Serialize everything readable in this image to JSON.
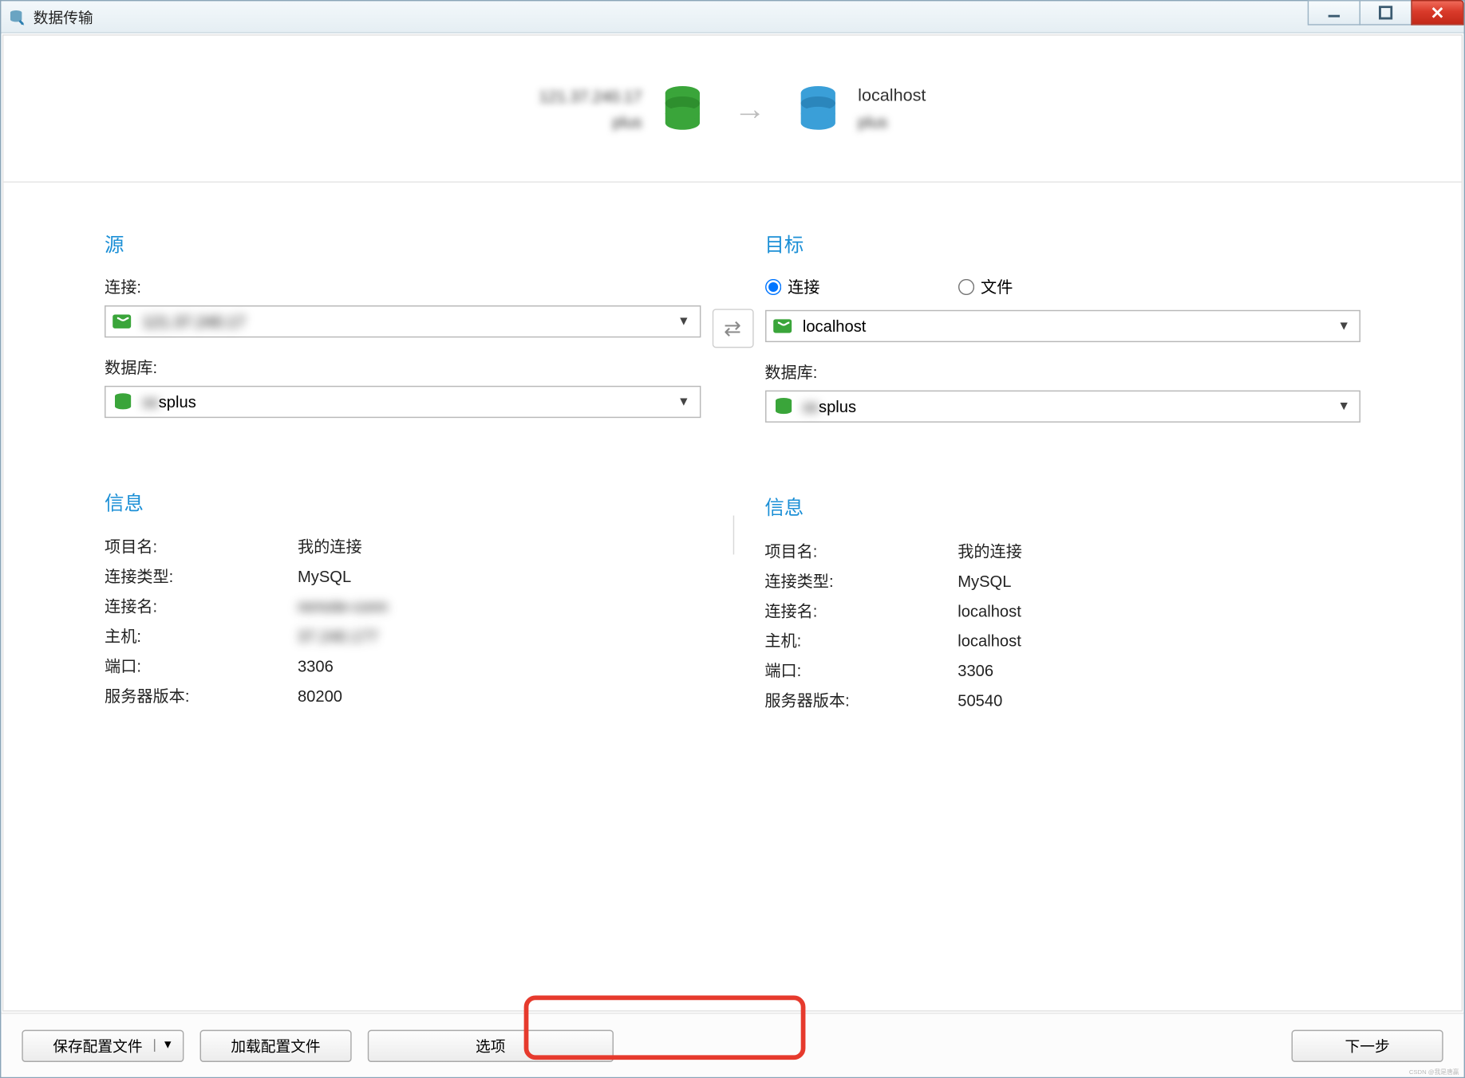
{
  "window": {
    "title": "数据传输"
  },
  "banner": {
    "source_line1": "121.37.240.17",
    "source_line2": "plus",
    "arrow": "→",
    "target_line1": "localhost",
    "target_line2": "plus"
  },
  "source": {
    "title": "源",
    "connection_label": "连接:",
    "connection_value": "121.37.240.17",
    "database_label": "数据库:",
    "database_value": "splus"
  },
  "target": {
    "title": "目标",
    "radio_connection": "连接",
    "radio_file": "文件",
    "connection_value": "localhost",
    "database_label": "数据库:",
    "database_value": "splus"
  },
  "source_info": {
    "title": "信息",
    "rows": [
      {
        "k": "项目名:",
        "v": "我的连接",
        "blur": false
      },
      {
        "k": "连接类型:",
        "v": "MySQL",
        "blur": false
      },
      {
        "k": "连接名:",
        "v": "remote-conn",
        "blur": true
      },
      {
        "k": "主机:",
        "v": "37.240.177",
        "blur": true
      },
      {
        "k": "端口:",
        "v": "3306",
        "blur": false
      },
      {
        "k": "服务器版本:",
        "v": "80200",
        "blur": false
      }
    ]
  },
  "target_info": {
    "title": "信息",
    "rows": [
      {
        "k": "项目名:",
        "v": "我的连接"
      },
      {
        "k": "连接类型:",
        "v": "MySQL"
      },
      {
        "k": "连接名:",
        "v": "localhost"
      },
      {
        "k": "主机:",
        "v": "localhost"
      },
      {
        "k": "端口:",
        "v": "3306"
      },
      {
        "k": "服务器版本:",
        "v": "50540"
      }
    ]
  },
  "footer": {
    "save_profile": "保存配置文件",
    "load_profile": "加载配置文件",
    "options": "选项",
    "next": "下一步"
  },
  "watermark": "CSDN @我是唐赢"
}
